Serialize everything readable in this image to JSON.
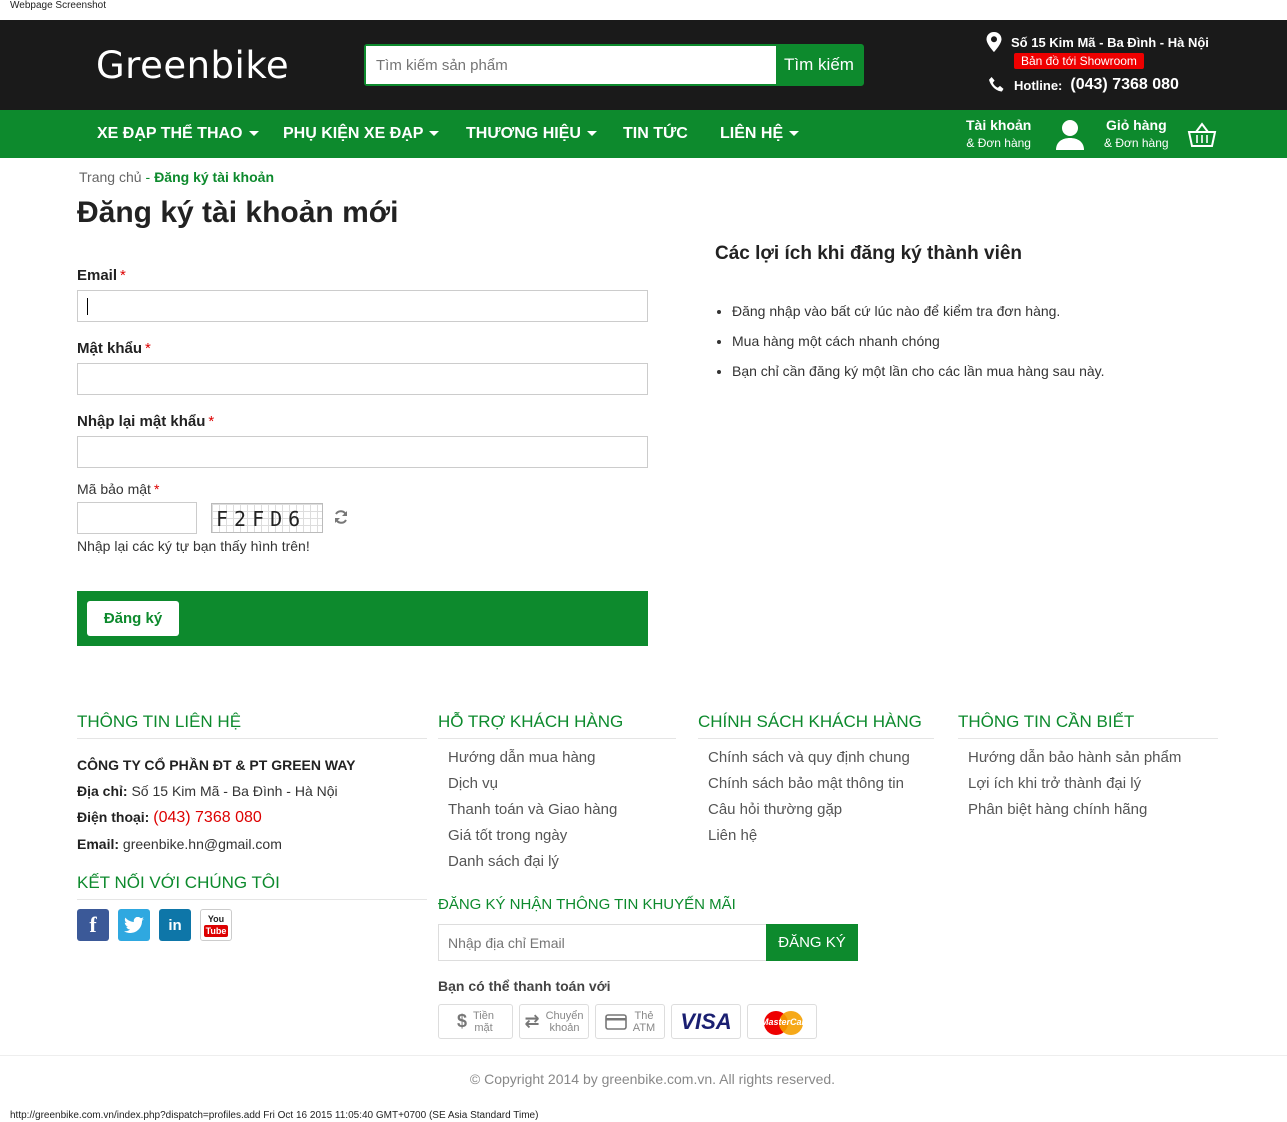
{
  "screenshot_caption": "Webpage Screenshot",
  "screenshot_url": "http://greenbike.com.vn/index.php?dispatch=profiles.add Fri Oct 16 2015 11:05:40 GMT+0700 (SE Asia Standard Time)",
  "header": {
    "logo": "Greenbike",
    "search_placeholder": "Tìm kiếm sản phẩm",
    "search_button": "Tìm kiếm",
    "address": "Số 15 Kim Mã - Ba Đình - Hà Nội",
    "map_badge": "Bản đồ tới Showroom",
    "hotline_label": "Hotline:",
    "hotline_number": "(043) 7368 080"
  },
  "nav": {
    "items": [
      {
        "label": "XE ĐẠP THỂ THAO"
      },
      {
        "label": "PHỤ KIỆN XE ĐẠP"
      },
      {
        "label": "THƯƠNG HIỆU"
      },
      {
        "label": "TIN TỨC"
      },
      {
        "label": "LIÊN HỆ"
      }
    ],
    "account_title": "Tài khoản",
    "account_sub": "& Đơn hàng",
    "cart_title": "Giỏ hàng",
    "cart_sub": "& Đơn hàng"
  },
  "breadcrumb": {
    "home": "Trang chủ",
    "separator": "-",
    "current": "Đăng ký tài khoản"
  },
  "page_title": "Đăng ký tài khoản mới",
  "form": {
    "email_label": "Email",
    "password_label": "Mật khẩu",
    "confirm_label": "Nhập lại mật khẩu",
    "required_mark": "*",
    "captcha_label": "Mã bảo mật",
    "captcha_text": "F2FD6",
    "captcha_hint": "Nhập lại các ký tự bạn thấy hình trên!",
    "submit": "Đăng ký"
  },
  "benefits": {
    "title": "Các lợi ích khi đăng ký thành viên",
    "items": [
      "Đăng nhập vào bất cứ lúc nào để kiểm tra đơn hàng.",
      "Mua hàng một cách nhanh chóng",
      "Bạn chỉ cần đăng ký một lần cho các lần mua hàng sau này."
    ]
  },
  "footer": {
    "contact_heading": "THÔNG TIN LIÊN HỆ",
    "company": "CÔNG TY CỔ PHẦN ĐT & PT GREEN WAY",
    "address_label": "Địa chỉ:",
    "address": "Số 15 Kim Mã - Ba Đình - Hà Nội",
    "phone_label": "Điện thoại:",
    "phone": "(043) 7368 080",
    "email_label": "Email:",
    "email": "greenbike.hn@gmail.com",
    "social_heading": "KẾT NỐI VỚI CHÚNG TÔI",
    "social": {
      "facebook": "f",
      "linkedin": "in",
      "youtube_top": "You",
      "youtube_bottom": "Tube"
    },
    "support_heading": "HỖ TRỢ KHÁCH HÀNG",
    "support_links": [
      "Hướng dẫn mua hàng",
      "Dịch vụ",
      "Thanh toán và Giao hàng",
      "Giá tốt trong ngày",
      "Danh sách đại lý"
    ],
    "policy_heading": "CHÍNH SÁCH KHÁCH HÀNG",
    "policy_links": [
      "Chính sách và quy định chung",
      "Chính sách bảo mật thông tin",
      "Câu hỏi thường gặp",
      "Liên hệ"
    ],
    "info_heading": "THÔNG TIN CẦN BIẾT",
    "info_links": [
      "Hướng dẫn bảo hành sản phẩm",
      "Lợi ích khi trở thành đại lý",
      "Phân biệt hàng chính hãng"
    ],
    "newsletter_heading": "ĐĂNG KÝ NHẬN THÔNG TIN KHUYẾN MÃI",
    "newsletter_placeholder": "Nhập địa chỉ Email",
    "newsletter_button": "ĐĂNG KÝ",
    "pay_heading": "Bạn có thể thanh toán với",
    "pay_methods": [
      {
        "line1": "Tiền",
        "line2": "mặt"
      },
      {
        "line1": "Chuyển",
        "line2": "khoản"
      },
      {
        "line1": "Thẻ",
        "line2": "ATM"
      }
    ],
    "visa": "VISA",
    "mastercard": "MasterCard",
    "copyright": "© Copyright 2014 by greenbike.com.vn. All rights reserved."
  },
  "colors": {
    "brand_green": "#0d8a2d",
    "header_dark": "#1a1a1a",
    "accent_red": "#e00000"
  }
}
